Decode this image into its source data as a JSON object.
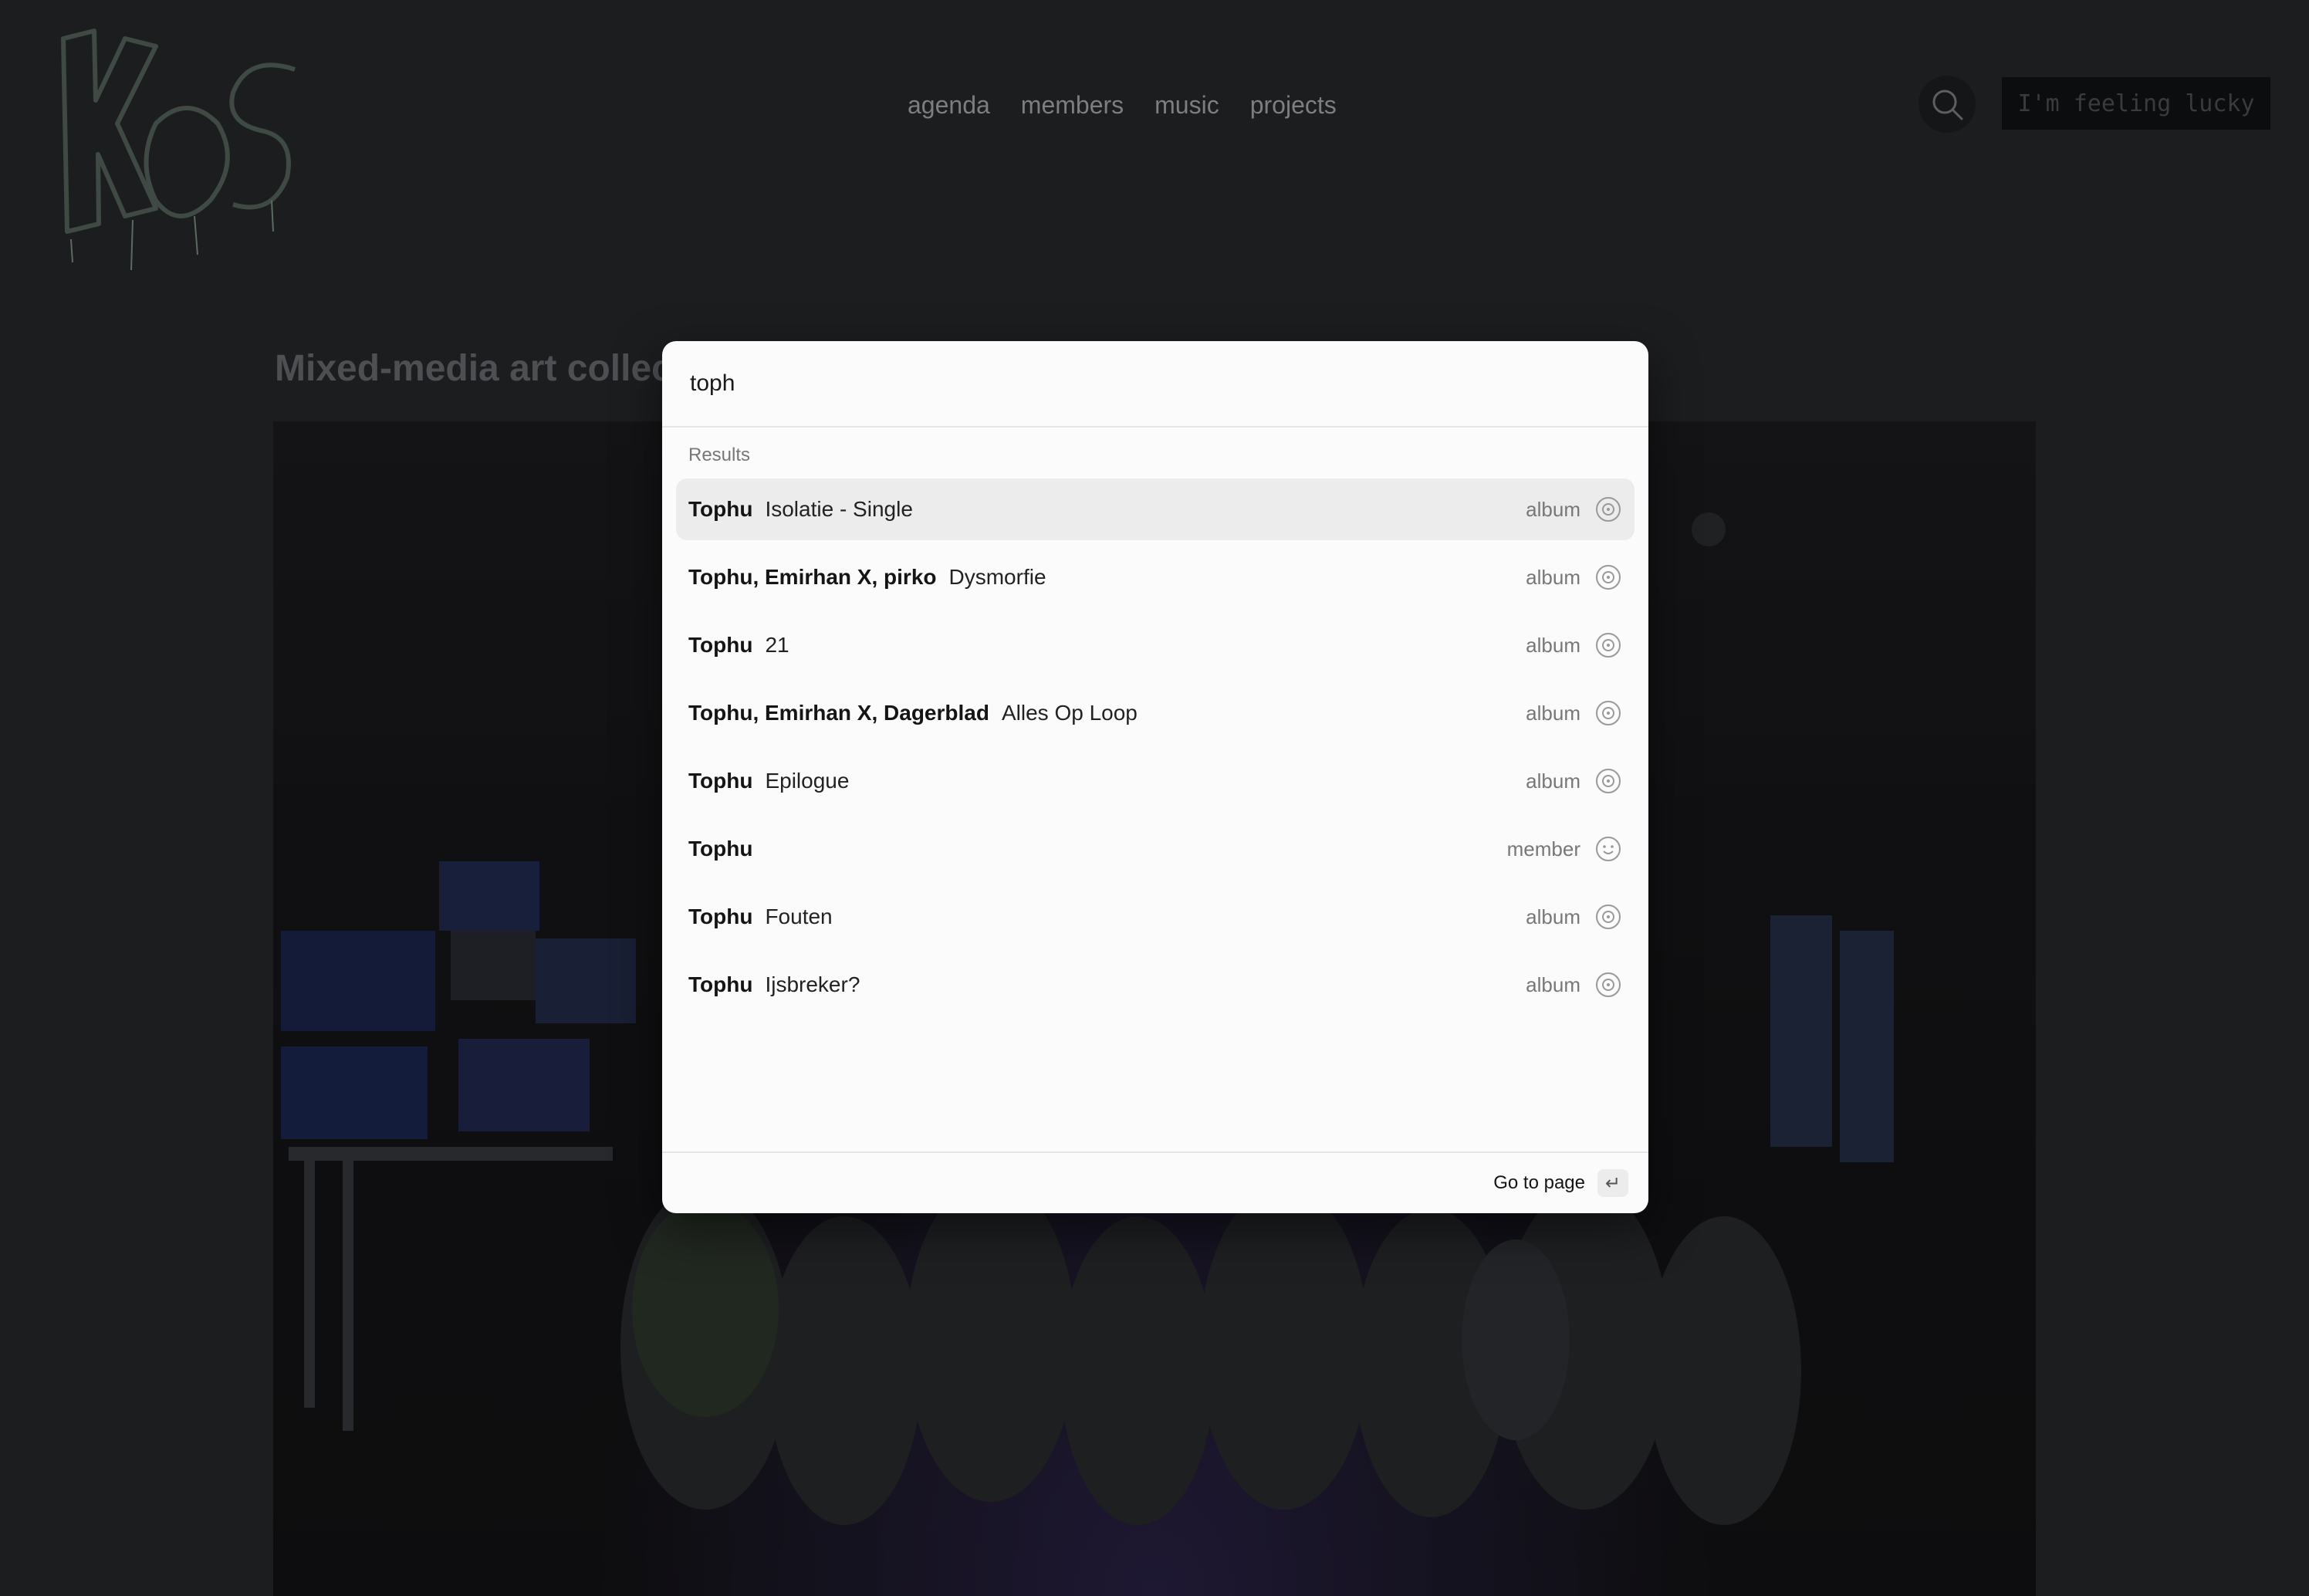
{
  "header": {
    "logo_text": "KOS",
    "nav": [
      "agenda",
      "members",
      "music",
      "projects"
    ],
    "search_icon": "search-icon",
    "lucky_label": "I'm feeling lucky"
  },
  "page": {
    "heading": "Mixed-media art collec"
  },
  "search": {
    "query": "toph",
    "results_label": "Results",
    "results": [
      {
        "artist": "Tophu",
        "title": "Isolatie - Single",
        "type": "album",
        "icon": "disc-icon",
        "active": true
      },
      {
        "artist": "Tophu, Emirhan X, pirko",
        "title": "Dysmorfie",
        "type": "album",
        "icon": "disc-icon"
      },
      {
        "artist": "Tophu",
        "title": "21",
        "type": "album",
        "icon": "disc-icon"
      },
      {
        "artist": "Tophu, Emirhan X, Dagerblad",
        "title": "Alles Op Loop",
        "type": "album",
        "icon": "disc-icon"
      },
      {
        "artist": "Tophu",
        "title": "Epilogue",
        "type": "album",
        "icon": "disc-icon"
      },
      {
        "artist": "Tophu",
        "title": "",
        "type": "member",
        "icon": "smiley-icon"
      },
      {
        "artist": "Tophu",
        "title": "Fouten",
        "type": "album",
        "icon": "disc-icon"
      },
      {
        "artist": "Tophu",
        "title": "Ijsbreker?",
        "type": "album",
        "icon": "disc-icon"
      }
    ],
    "footer_label": "Go to page",
    "enter_key": "↵"
  }
}
